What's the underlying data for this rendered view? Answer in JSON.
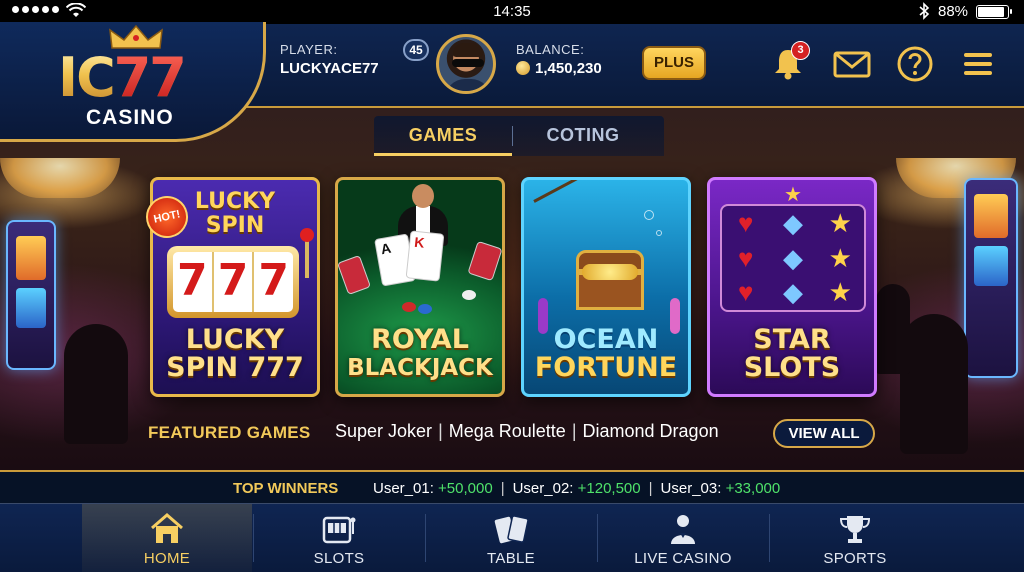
{
  "status_bar": {
    "time": "14:35",
    "battery": "88%",
    "battery_level": 0.88
  },
  "brand": {
    "logo_main": "IC77",
    "logo_sub": "CASINO"
  },
  "player": {
    "label": "PLAYER:",
    "name": "LUCKYACE77",
    "level": "45"
  },
  "balance": {
    "label": "BALANCE:",
    "amount": "1,450,230",
    "plus_label": "PLUS"
  },
  "notifications": {
    "count": "3"
  },
  "tabs": [
    {
      "label": "GAMES",
      "active": true
    },
    {
      "label": "COTING",
      "active": false
    }
  ],
  "games": [
    {
      "badge": "HOT!",
      "top_line1": "LUCKY",
      "top_line2": "SPIN",
      "reels": [
        "7",
        "7",
        "7"
      ],
      "title_line1": "LUCKY",
      "title_line2": "SPIN 777"
    },
    {
      "cards": [
        "A",
        "K"
      ],
      "title_line1": "ROYAL",
      "title_line2": "BLACKJACK"
    },
    {
      "title_line1": "OCEAN",
      "title_line2": "FORTUNE"
    },
    {
      "title_line1": "STAR",
      "title_line2": "SLOTS"
    }
  ],
  "featured": {
    "label": "FEATURED GAMES",
    "items": [
      "Super Joker",
      "Mega Roulette",
      "Diamond Dragon"
    ],
    "view_all_label": "VIEW ALL"
  },
  "top_winners": {
    "label": "TOP WINNERS",
    "entries": [
      {
        "user": "User_01:",
        "amount": "+50,000"
      },
      {
        "user": "User_02:",
        "amount": "+120,500"
      },
      {
        "user": "User_03:",
        "amount": "+33,000"
      }
    ]
  },
  "bottom_nav": [
    {
      "label": "HOME",
      "icon": "home-icon",
      "active": true
    },
    {
      "label": "SLOTS",
      "icon": "slot-machine-icon",
      "active": false
    },
    {
      "label": "TABLE",
      "icon": "playing-cards-icon",
      "active": false
    },
    {
      "label": "LIVE CASINO",
      "icon": "dealer-icon",
      "active": false
    },
    {
      "label": "SPORTS",
      "icon": "trophy-icon",
      "active": false
    }
  ],
  "colors": {
    "accent_gold": "#f2c95a",
    "win_green": "#4fe26a",
    "nav_bg": "#0f2552"
  }
}
